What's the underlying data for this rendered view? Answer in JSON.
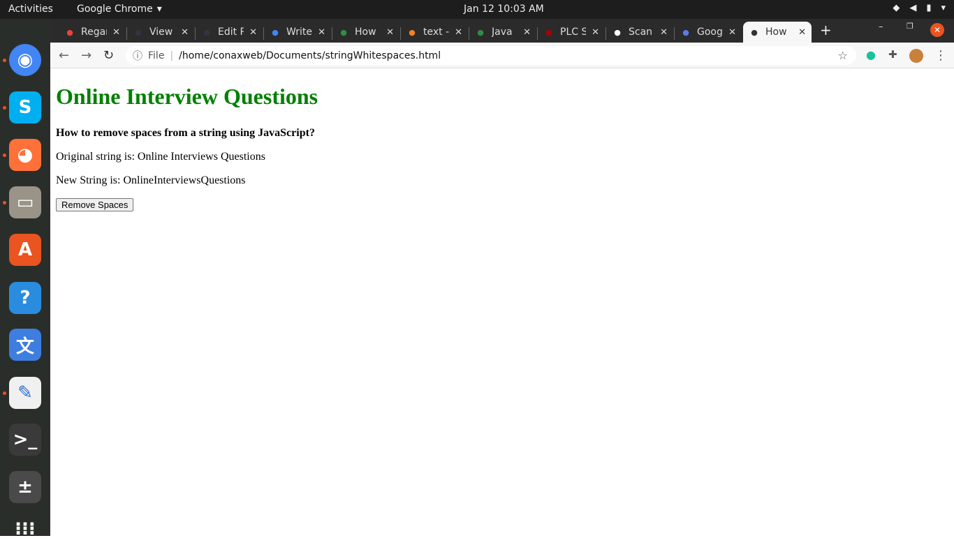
{
  "topbar": {
    "activities": "Activities",
    "app": "Google Chrome",
    "clock": "Jan 12  10:03 AM"
  },
  "dock": [
    {
      "icon": "chrome-icon",
      "color": "#4285f4"
    },
    {
      "icon": "skype-icon",
      "color": "#00aff0"
    },
    {
      "icon": "firefox-icon",
      "color": "#ff7139"
    },
    {
      "icon": "files-icon",
      "color": "#9a9488"
    },
    {
      "icon": "software-center-icon",
      "color": "#e95420"
    },
    {
      "icon": "help-icon",
      "color": "#2a8cdf"
    },
    {
      "icon": "translate-icon",
      "color": "#3d7ee0"
    },
    {
      "icon": "text-editor-icon",
      "color": "#f0f0f0"
    },
    {
      "icon": "terminal-icon",
      "color": "#3a3a3a"
    },
    {
      "icon": "calculator-icon",
      "color": "#4a4a4a"
    },
    {
      "icon": "app-grid-icon",
      "color": "transparent"
    }
  ],
  "tabs": [
    {
      "label": "Regarding",
      "icon": "gmail-icon"
    },
    {
      "label": "View",
      "icon": "gear-icon"
    },
    {
      "label": "Edit Post",
      "icon": "gear-icon"
    },
    {
      "label": "Write",
      "icon": "google-icon"
    },
    {
      "label": "How",
      "icon": "gfg-icon"
    },
    {
      "label": "text -",
      "icon": "stackoverflow-icon"
    },
    {
      "label": "Java",
      "icon": "gfg-icon"
    },
    {
      "label": "PLC S",
      "icon": "a2z-icon"
    },
    {
      "label": "Scan",
      "icon": "scan-icon"
    },
    {
      "label": "Goog",
      "icon": "google-translate-icon"
    },
    {
      "label": "How",
      "icon": "globe-icon",
      "active": true
    }
  ],
  "toolbar": {
    "scheme": "File",
    "url": "/home/conaxweb/Documents/stringWhitespaces.html"
  },
  "page": {
    "title": "Online Interview Questions",
    "question": "How to remove spaces from a string using JavaScript?",
    "original": "Original string is: Online Interviews Questions",
    "result": "New String is: OnlineInterviewsQuestions",
    "button": "Remove Spaces"
  }
}
